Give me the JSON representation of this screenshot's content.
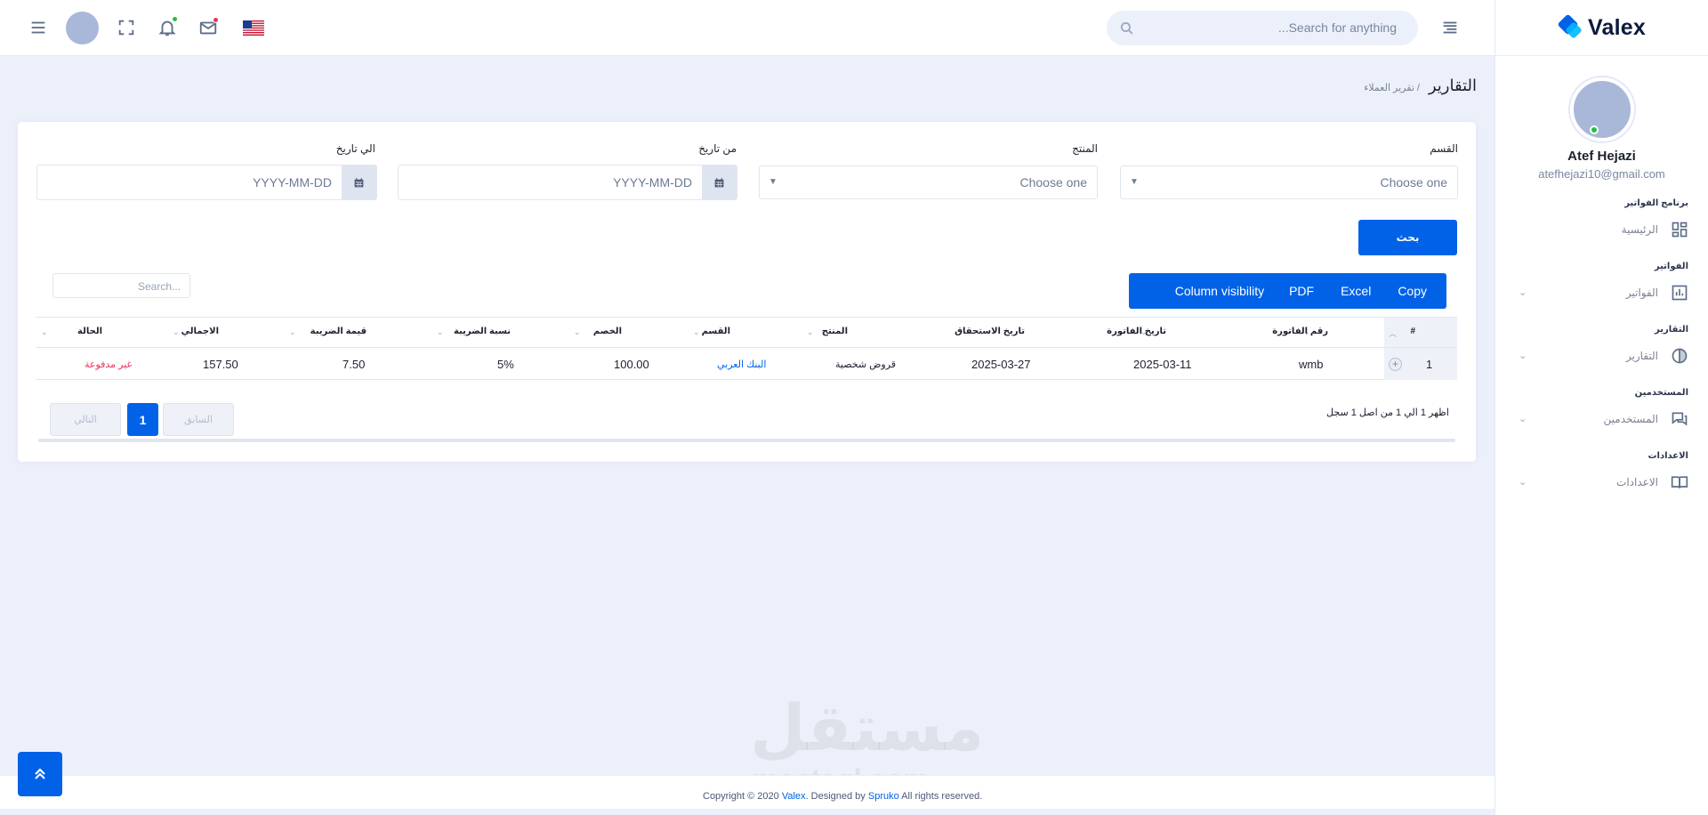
{
  "brand": {
    "name": "Valex"
  },
  "user": {
    "name": "Atef Hejazi",
    "email": "atefhejazi10@gmail.com"
  },
  "header": {
    "search_placeholder": "...Search for anything"
  },
  "sidebar": {
    "sections": [
      {
        "title": "برنامج الفواتير",
        "item": "الرئيسية",
        "icon": "dashboard-icon"
      },
      {
        "title": "الفواتير",
        "item": "الفواتير",
        "icon": "invoice-chart-icon"
      },
      {
        "title": "التقارير",
        "item": "التقارير",
        "icon": "pie-chart-icon"
      },
      {
        "title": "المستخدمين",
        "item": "المستخدمين",
        "icon": "chat-users-icon"
      },
      {
        "title": "الاعدادات",
        "item": "الاعدادات",
        "icon": "book-settings-icon"
      }
    ]
  },
  "page": {
    "title": "التقارير",
    "breadcrumb": "/ تقرير العملاء"
  },
  "filters": {
    "section_label": "القسم",
    "section_value": "Choose one",
    "product_label": "المنتج",
    "product_value": "Choose one",
    "from_label": "من تاريخ",
    "from_placeholder": "YYYY-MM-DD",
    "to_label": "الي تاريخ",
    "to_placeholder": "YYYY-MM-DD",
    "search_button": "بحث"
  },
  "toolbar": {
    "copy": "Copy",
    "excel": "Excel",
    "pdf": "PDF",
    "column_visibility": "Column visibility",
    "table_search_placeholder": "Search..."
  },
  "table": {
    "headers": [
      "#",
      "رقم الفاتورة",
      "تاريخ الفاتورة",
      "تاريخ الاستحقاق",
      "المنتج",
      "القسم",
      "الخصم",
      "نسبة الضريبة",
      "قيمة الضريبة",
      "الاجمالي",
      "الحالة"
    ],
    "rows": [
      [
        "1",
        "wmb",
        "2025-03-11",
        "2025-03-27",
        "قروض شخصية",
        "البنك العربي",
        "100.00",
        "5%",
        "7.50",
        "157.50",
        "غير مدفوعة"
      ]
    ]
  },
  "pagination": {
    "info": "اظهر 1 الي 1 من اصل 1 سجل",
    "previous": "السابق",
    "current": "1",
    "next": "التالي"
  },
  "footer": {
    "prefix": "Copyright © 2020 ",
    "brand": "Valex",
    "middle": ". Designed by ",
    "designer": "Spruko",
    "suffix": " All rights reserved."
  },
  "watermark": {
    "arabic": "مستقل",
    "latin": "mostaql.com"
  },
  "colors": {
    "primary": "#0162e8",
    "danger": "#ee335e",
    "link": "#0162e8",
    "online": "#22c03c"
  }
}
